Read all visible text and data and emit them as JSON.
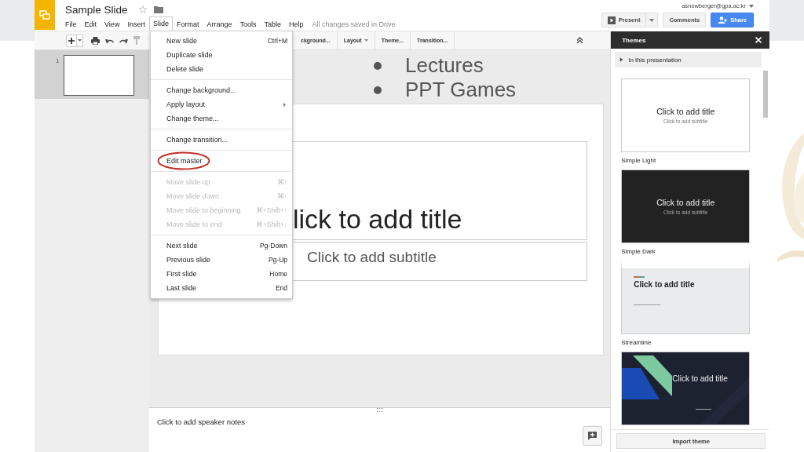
{
  "slide_bullets": [
    "Lectures",
    "PPT Games"
  ],
  "document": {
    "title": "Sample Slide",
    "starred": false,
    "save_status": "All changes saved in Drive"
  },
  "menu_bar": [
    {
      "label": "File",
      "selected": false
    },
    {
      "label": "Edit",
      "selected": false
    },
    {
      "label": "View",
      "selected": false
    },
    {
      "label": "Insert",
      "selected": false
    },
    {
      "label": "Slide",
      "selected": true
    },
    {
      "label": "Format",
      "selected": false
    },
    {
      "label": "Arrange",
      "selected": false
    },
    {
      "label": "Tools",
      "selected": false
    },
    {
      "label": "Table",
      "selected": false
    },
    {
      "label": "Help",
      "selected": false
    }
  ],
  "account": {
    "email": "asnowberger@gpa.ac.kr"
  },
  "header_buttons": {
    "present": "Present",
    "comments": "Comments",
    "share": "Share"
  },
  "toolbar": {
    "text_buttons": [
      {
        "label": "ckground...",
        "dropdown": false
      },
      {
        "label": "Layout",
        "dropdown": true
      },
      {
        "label": "Theme...",
        "dropdown": false
      },
      {
        "label": "Transition...",
        "dropdown": false
      }
    ]
  },
  "filmstrip": [
    {
      "number": "1",
      "selected": true
    }
  ],
  "slide": {
    "title_placeholder": "lick to add title",
    "subtitle_placeholder": "Click to add subtitle"
  },
  "speaker_notes": {
    "placeholder": "Click to add speaker notes"
  },
  "slide_menu": {
    "groups": [
      [
        {
          "label": "New slide",
          "shortcut": "Ctrl+M",
          "disabled": false,
          "submenu": false,
          "circled": false
        },
        {
          "label": "Duplicate slide",
          "disabled": false,
          "submenu": false,
          "circled": false
        },
        {
          "label": "Delete slide",
          "disabled": false,
          "submenu": false,
          "circled": false
        }
      ],
      [
        {
          "label": "Change background...",
          "disabled": false,
          "submenu": false,
          "circled": false
        },
        {
          "label": "Apply layout",
          "disabled": false,
          "submenu": true,
          "circled": false
        },
        {
          "label": "Change theme...",
          "disabled": false,
          "submenu": false,
          "circled": false
        }
      ],
      [
        {
          "label": "Change transition...",
          "disabled": false,
          "submenu": false,
          "circled": false
        }
      ],
      [
        {
          "label": "Edit master",
          "disabled": false,
          "submenu": false,
          "circled": true
        }
      ],
      [
        {
          "label": "Move slide up",
          "shortcut": "⌘↑",
          "disabled": true,
          "submenu": false,
          "circled": false
        },
        {
          "label": "Move slide down",
          "shortcut": "⌘↓",
          "disabled": true,
          "submenu": false,
          "circled": false
        },
        {
          "label": "Move slide to beginning",
          "shortcut": "⌘+Shift+↑",
          "disabled": true,
          "submenu": false,
          "circled": false
        },
        {
          "label": "Move slide to end",
          "shortcut": "⌘+Shift+↓",
          "disabled": true,
          "submenu": false,
          "circled": false
        }
      ],
      [
        {
          "label": "Next slide",
          "shortcut": "Pg-Down",
          "disabled": false,
          "submenu": false,
          "circled": false
        },
        {
          "label": "Previous slide",
          "shortcut": "Pg-Up",
          "disabled": false,
          "submenu": false,
          "circled": false
        },
        {
          "label": "First slide",
          "shortcut": "Home",
          "disabled": false,
          "submenu": false,
          "circled": false
        },
        {
          "label": "Last slide",
          "shortcut": "End",
          "disabled": false,
          "submenu": false,
          "circled": false
        }
      ]
    ]
  },
  "themes_panel": {
    "title": "Themes",
    "section": "In this presentation",
    "expanded": false,
    "themes": [
      {
        "kind": "light",
        "name": "Simple Light",
        "title": "Click to add title",
        "subtitle": "Click to add subtitle"
      },
      {
        "kind": "dark",
        "name": "Simple Dark",
        "title": "Click to add title",
        "subtitle": "Click to add subtitle"
      },
      {
        "kind": "streamline",
        "name": "Streamline",
        "title": "Click to add title"
      },
      {
        "kind": "focus",
        "title": "Click to add title"
      }
    ],
    "import_button": "Import theme"
  }
}
